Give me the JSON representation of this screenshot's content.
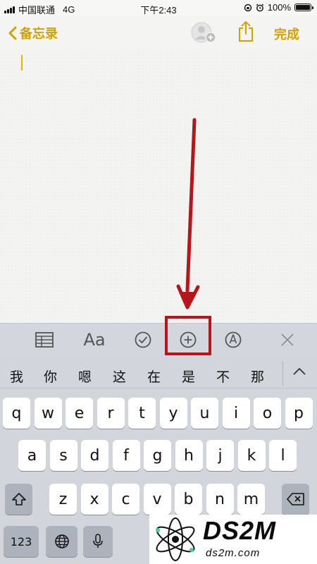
{
  "status_bar": {
    "carrier": "中国联通",
    "network": "4G",
    "time": "下午2:43",
    "battery": "100%",
    "battery_level": 1.0
  },
  "nav": {
    "back_label": "备忘录",
    "done_label": "完成",
    "accent_color": "#d4a200"
  },
  "toolbar": {
    "text_style_label": "Aa",
    "tools": [
      "table-icon",
      "text-style-icon",
      "checklist-icon",
      "add-icon",
      "markup-icon",
      "close-icon"
    ]
  },
  "keyboard": {
    "candidates": [
      "我",
      "你",
      "嗯",
      "这",
      "在",
      "是",
      "不",
      "那"
    ],
    "row1": [
      "q",
      "w",
      "e",
      "r",
      "t",
      "y",
      "u",
      "i",
      "o",
      "p"
    ],
    "row2": [
      "a",
      "s",
      "d",
      "f",
      "g",
      "h",
      "j",
      "k",
      "l"
    ],
    "row3": [
      "z",
      "x",
      "c",
      "v",
      "b",
      "n",
      "m"
    ],
    "numbers_label": "123"
  },
  "annotation": {
    "color": "#b4161b"
  },
  "watermark": {
    "main": "DS2M",
    "sub": "ds2m.com"
  }
}
